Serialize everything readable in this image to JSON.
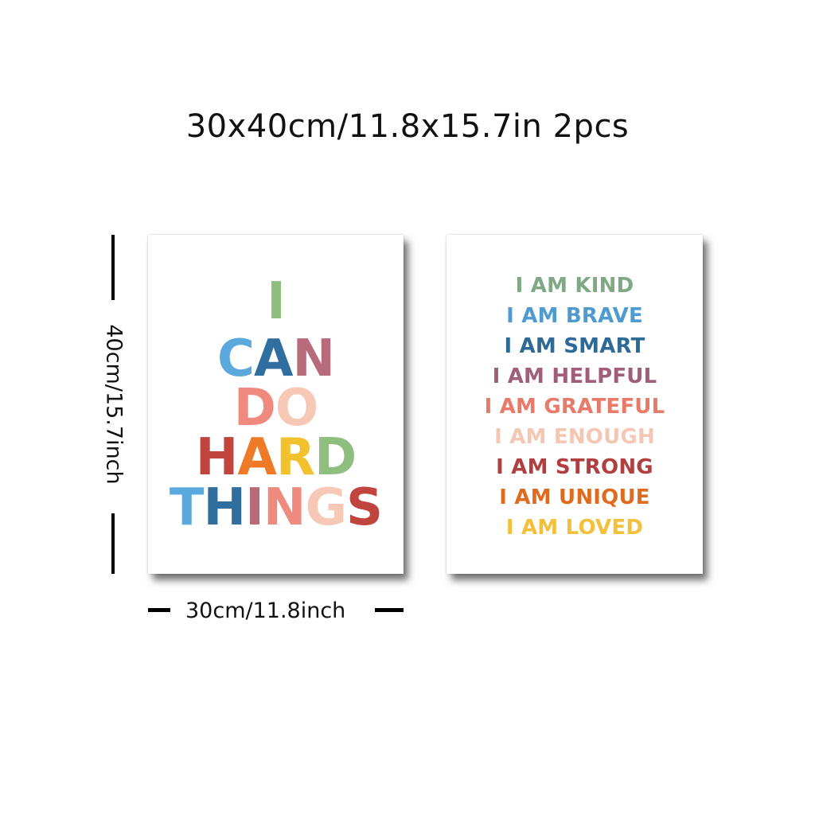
{
  "headline": "30x40cm/11.8x15.7in 2pcs",
  "dimensions": {
    "height_label": "40cm/15.7inch",
    "width_label": "30cm/11.8inch"
  },
  "poster_left": {
    "lines": [
      {
        "letters": [
          {
            "char": "I",
            "color": "#8fbf7f"
          }
        ]
      },
      {
        "letters": [
          {
            "char": "C",
            "color": "#5aa9dc"
          },
          {
            "char": "A",
            "color": "#2f6e9e"
          },
          {
            "char": "N",
            "color": "#b86b7a"
          }
        ]
      },
      {
        "letters": [
          {
            "char": "D",
            "color": "#ef8a7e"
          },
          {
            "char": "O",
            "color": "#f7c8b6"
          }
        ]
      },
      {
        "letters": [
          {
            "char": "H",
            "color": "#c0453e"
          },
          {
            "char": "A",
            "color": "#ee7a28"
          },
          {
            "char": "R",
            "color": "#f2c12e"
          },
          {
            "char": "D",
            "color": "#8fbf7f"
          }
        ]
      },
      {
        "letters": [
          {
            "char": "T",
            "color": "#5aa9dc"
          },
          {
            "char": "H",
            "color": "#2f6e9e"
          },
          {
            "char": "I",
            "color": "#b86b7a"
          },
          {
            "char": "N",
            "color": "#ef8a7e"
          },
          {
            "char": "G",
            "color": "#f7c8b6"
          },
          {
            "char": "S",
            "color": "#c0453e"
          }
        ]
      }
    ]
  },
  "poster_right": {
    "affirmations": [
      {
        "text": "I AM KIND",
        "color": "#7fa982"
      },
      {
        "text": "I AM BRAVE",
        "color": "#4f9bd0"
      },
      {
        "text": "I AM SMART",
        "color": "#2e6a96"
      },
      {
        "text": "I AM HELPFUL",
        "color": "#a05e7a"
      },
      {
        "text": "I AM GRATEFUL",
        "color": "#e87a6a"
      },
      {
        "text": "I AM ENOUGH",
        "color": "#f4c6b4"
      },
      {
        "text": "I AM STRONG",
        "color": "#b23f40"
      },
      {
        "text": "I AM UNIQUE",
        "color": "#e06b1e"
      },
      {
        "text": "I AM LOVED",
        "color": "#f2c03a"
      }
    ]
  }
}
